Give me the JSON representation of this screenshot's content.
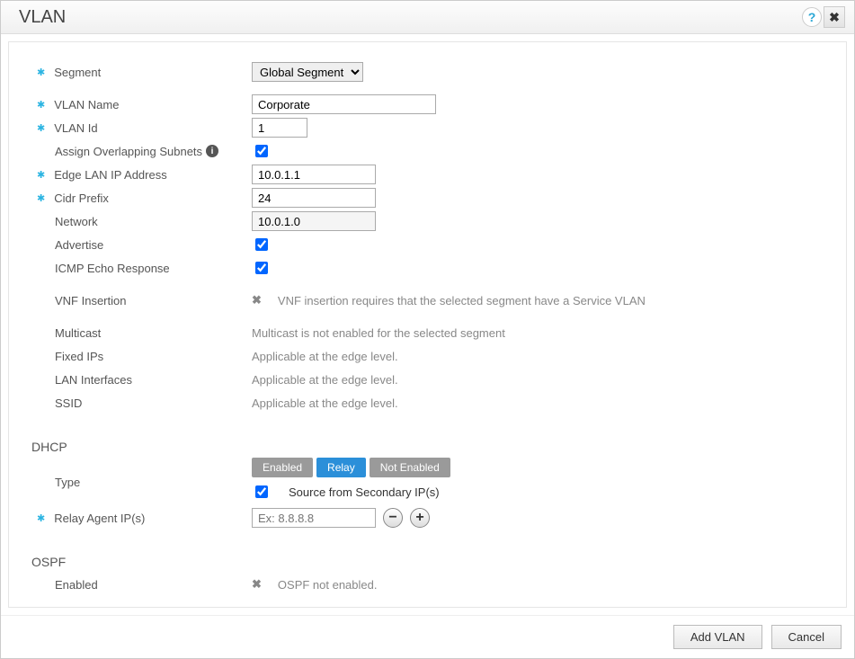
{
  "title": "VLAN",
  "form": {
    "segment": {
      "label": "Segment",
      "selected": "Global Segment",
      "options": [
        "Global Segment"
      ]
    },
    "vlan_name": {
      "label": "VLAN Name",
      "value": "Corporate"
    },
    "vlan_id": {
      "label": "VLAN Id",
      "value": "1"
    },
    "overlap": {
      "label": "Assign Overlapping Subnets",
      "checked": true
    },
    "edge_ip": {
      "label": "Edge LAN IP Address",
      "value": "10.0.1.1"
    },
    "cidr": {
      "label": "Cidr Prefix",
      "value": "24"
    },
    "network": {
      "label": "Network",
      "value": "10.0.1.0"
    },
    "advertise": {
      "label": "Advertise",
      "checked": true
    },
    "icmp": {
      "label": "ICMP Echo Response",
      "checked": true
    },
    "vnf": {
      "label": "VNF Insertion",
      "msg": "VNF insertion requires that the selected segment have a Service VLAN"
    },
    "multicast": {
      "label": "Multicast",
      "msg": "Multicast is not enabled for the selected segment"
    },
    "fixed_ips": {
      "label": "Fixed IPs",
      "msg": "Applicable at the edge level."
    },
    "lan_if": {
      "label": "LAN Interfaces",
      "msg": "Applicable at the edge level."
    },
    "ssid": {
      "label": "SSID",
      "msg": "Applicable at the edge level."
    }
  },
  "dhcp": {
    "title": "DHCP",
    "type_label": "Type",
    "buttons": {
      "enabled": "Enabled",
      "relay": "Relay",
      "not_enabled": "Not Enabled"
    },
    "active": "relay",
    "source_label": "Source from Secondary IP(s)",
    "source_checked": true,
    "relay_label": "Relay Agent IP(s)",
    "relay_placeholder": "Ex: 8.8.8.8"
  },
  "ospf": {
    "title": "OSPF",
    "enabled_label": "Enabled",
    "msg": "OSPF not enabled."
  },
  "footer": {
    "add": "Add VLAN",
    "cancel": "Cancel"
  }
}
